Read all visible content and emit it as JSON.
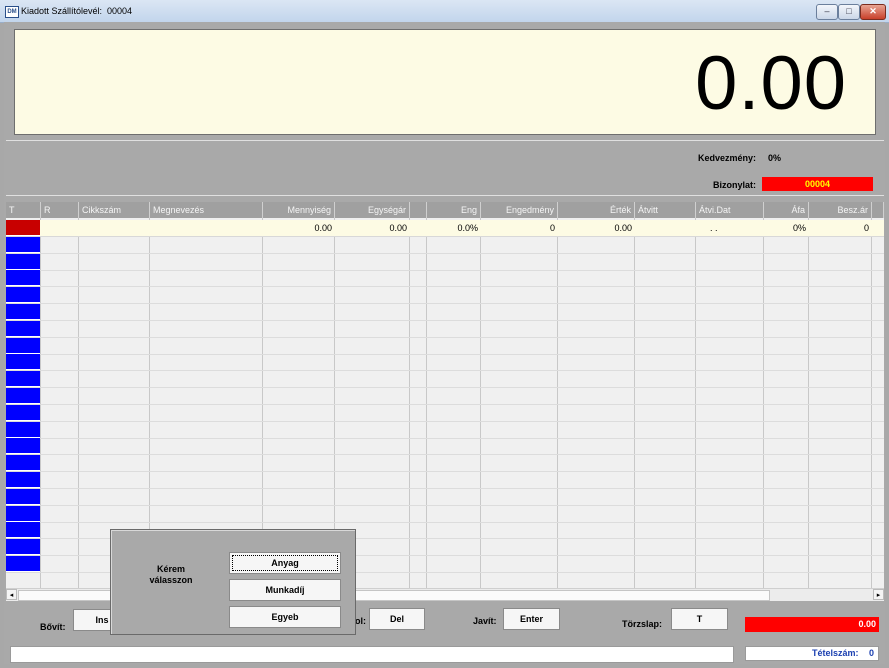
{
  "window": {
    "title": "Kiadott Szállítólevél:",
    "doc_number": "00004",
    "icon_text": "DM",
    "controls": {
      "minimize": "–",
      "maximize": "□",
      "close": "✕"
    }
  },
  "display": {
    "amount": "0.00"
  },
  "info": {
    "discount_label": "Kedvezmény:",
    "discount_value": "0%",
    "document_label": "Bizonylat:",
    "document_value": "00004"
  },
  "table": {
    "headers": [
      "T",
      "R",
      "Cikkszám",
      "Megnevezés",
      "Mennyiség",
      "Egységár",
      "",
      "Eng",
      "Engedmény",
      "Érték",
      "Átvitt",
      "Átvi.Dat",
      "Áfa",
      "Besz.ár"
    ],
    "first_row": {
      "mennyiseg": "0.00",
      "egysegar": "0.00",
      "eng": "0.0%",
      "engedmeny": "0",
      "ertek": "0.00",
      "atvi_dat": ". .",
      "afa": "0%",
      "besz_ar": "0"
    },
    "row_count": 21
  },
  "scroll": {
    "left": "◂",
    "right": "▸"
  },
  "bottom": {
    "bovit_label": "Bővít:",
    "bovit_btn": "Ins",
    "torol_label": "ol:",
    "torol_btn": "Del",
    "javit_label": "Javít:",
    "javit_btn": "Enter",
    "torzslap_label": "Törzslap:",
    "torzslap_btn": "T",
    "total": "0.00",
    "tetel_label": "Tételszám:",
    "tetel_value": "0"
  },
  "popup": {
    "prompt_line1": "Kérem",
    "prompt_line2": "válasszon",
    "options": [
      "Anyag",
      "Munkadíj",
      "Egyeb"
    ]
  },
  "colors": {
    "accent_red": "#ff0000",
    "row_marker_blue": "#0000ff",
    "active_marker": "#c80000",
    "display_bg": "#fdfbe4"
  }
}
